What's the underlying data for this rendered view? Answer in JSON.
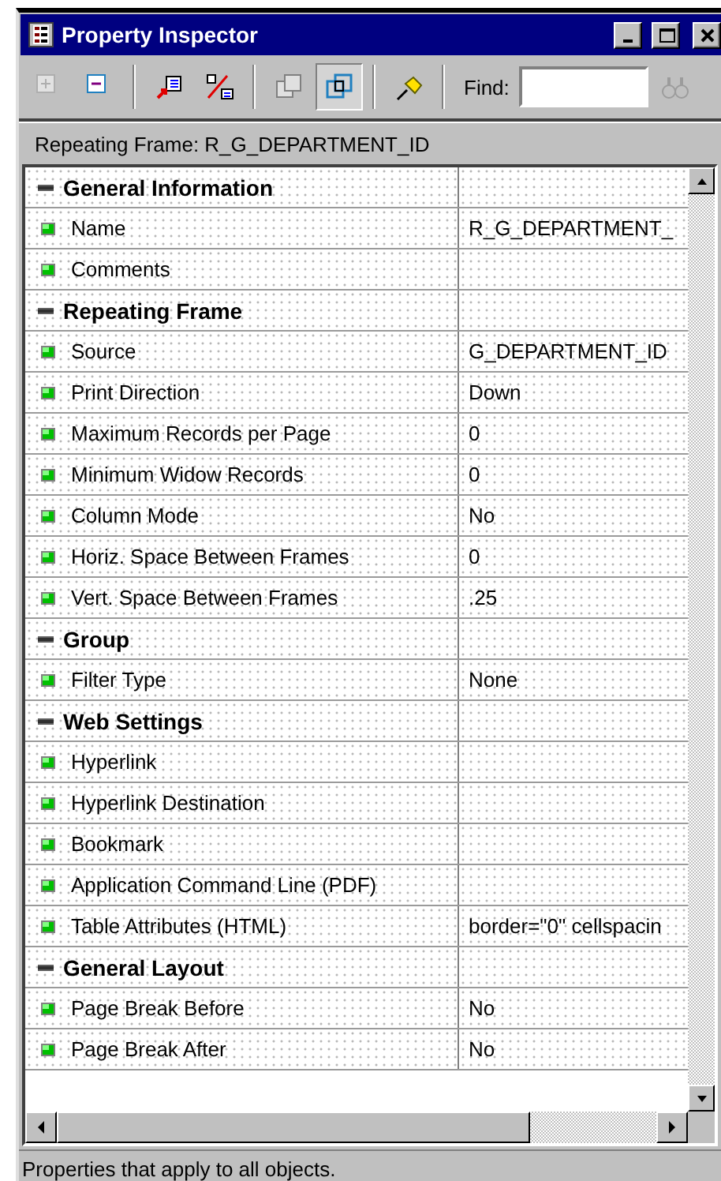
{
  "window": {
    "title": "Property Inspector",
    "controls": [
      {
        "kind": "minimize"
      },
      {
        "kind": "maximize"
      },
      {
        "kind": "close"
      }
    ]
  },
  "toolbar": {
    "buttons": [
      {
        "kind": "expand",
        "disabled": true,
        "pressed": false
      },
      {
        "kind": "collapse",
        "disabled": false,
        "pressed": false
      },
      {
        "kind": "separator"
      },
      {
        "kind": "set-property",
        "disabled": false,
        "pressed": false
      },
      {
        "kind": "clear-property",
        "disabled": false,
        "pressed": false
      },
      {
        "kind": "separator"
      },
      {
        "kind": "union",
        "disabled": false,
        "pressed": false
      },
      {
        "kind": "intersection",
        "disabled": false,
        "pressed": true
      },
      {
        "kind": "separator"
      },
      {
        "kind": "pin",
        "disabled": false,
        "pressed": false
      },
      {
        "kind": "separator"
      },
      {
        "kind": "find",
        "label": "Find:"
      },
      {
        "kind": "find-next",
        "disabled": true,
        "pressed": false
      }
    ]
  },
  "context": "Repeating Frame: R_G_DEPARTMENT_ID",
  "sections": [
    {
      "title": "General Information",
      "expanded": true,
      "properties": [
        {
          "name": "Name",
          "value": "R_G_DEPARTMENT_"
        },
        {
          "name": "Comments"
        }
      ]
    },
    {
      "title": "Repeating Frame",
      "expanded": true,
      "properties": [
        {
          "name": "Source",
          "value": "G_DEPARTMENT_ID"
        },
        {
          "name": "Print Direction",
          "value": "Down"
        },
        {
          "name": "Maximum Records per Page",
          "value": "0"
        },
        {
          "name": "Minimum Widow Records",
          "value": "0"
        },
        {
          "name": "Column Mode",
          "value": "No"
        },
        {
          "name": "Horiz. Space Between Frames",
          "value": "0"
        },
        {
          "name": "Vert. Space Between Frames",
          "value": ".25"
        }
      ]
    },
    {
      "title": "Group",
      "expanded": true,
      "properties": [
        {
          "name": "Filter Type",
          "value": "None"
        }
      ]
    },
    {
      "title": "Web Settings",
      "expanded": true,
      "properties": [
        {
          "name": "Hyperlink"
        },
        {
          "name": "Hyperlink Destination"
        },
        {
          "name": "Bookmark"
        },
        {
          "name": "Application Command Line (PDF)"
        },
        {
          "name": "Table Attributes (HTML)",
          "value": "border=\"0\" cellspacin"
        }
      ]
    },
    {
      "title": "General Layout",
      "expanded": true,
      "properties": [
        {
          "name": "Page Break Before",
          "value": "No"
        },
        {
          "name": "Page Break After",
          "value": "No"
        }
      ]
    }
  ],
  "status_bar": "Properties that apply to all objects."
}
